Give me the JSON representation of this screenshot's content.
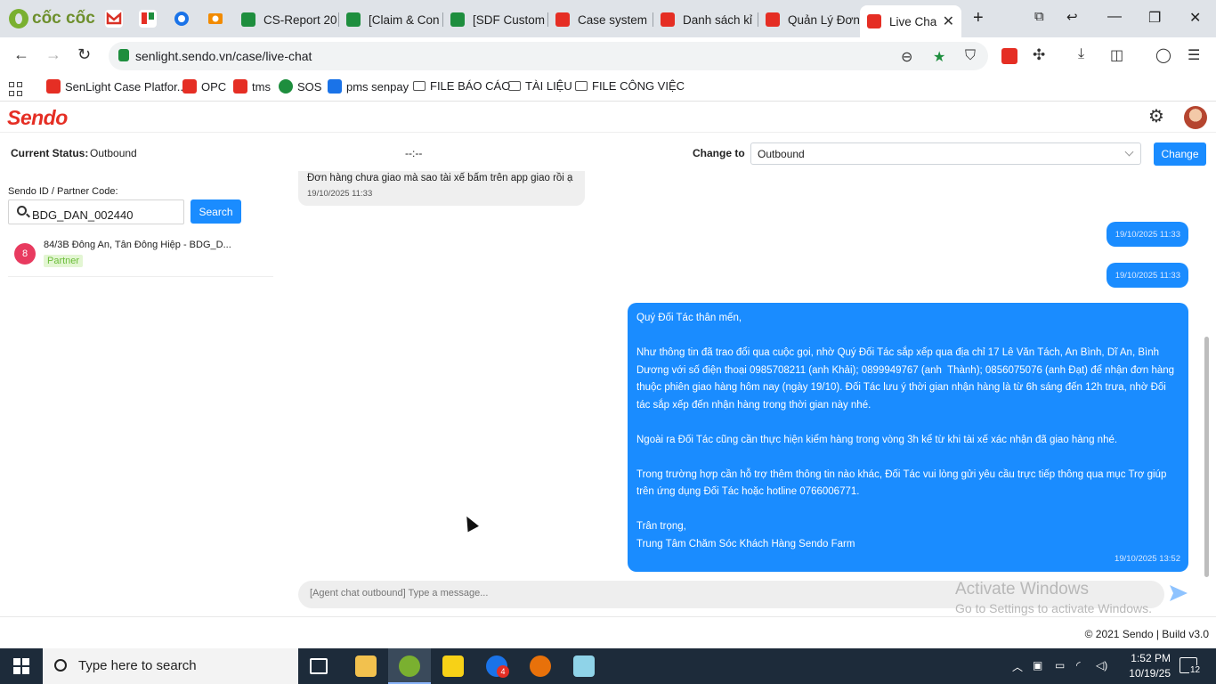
{
  "browser": {
    "brand_name": "cốc cốc",
    "tabs": [
      {
        "label": "CS-Report 20",
        "color": "#1e8e3e"
      },
      {
        "label": "[Claim & Con",
        "color": "#1e8e3e"
      },
      {
        "label": "[SDF Custom",
        "color": "#1e8e3e"
      },
      {
        "label": "Case system",
        "color": "#e52e24"
      },
      {
        "label": "Danh sách kỉ",
        "color": "#e52e24"
      },
      {
        "label": "Quản Lý Đơn",
        "color": "#e52e24"
      },
      {
        "label": "Live Cha",
        "color": "#e52e24"
      }
    ],
    "new_tab_label": "+",
    "url": "senlight.sendo.vn/case/live-chat",
    "bookmarks": [
      {
        "label": "SenLight Case Platfor...",
        "icon": "sendo-icon"
      },
      {
        "label": "OPC",
        "icon": "sendo-icon"
      },
      {
        "label": "tms",
        "icon": "sendo-icon"
      },
      {
        "label": "SOS",
        "icon": "sos-icon"
      },
      {
        "label": "pms senpay",
        "icon": "senpay-icon"
      },
      {
        "label": "FILE BÁO CÁO",
        "icon": "folder-icon"
      },
      {
        "label": "TÀI LIỆU",
        "icon": "folder-icon"
      },
      {
        "label": "FILE CÔNG VIỆC",
        "icon": "folder-icon"
      }
    ]
  },
  "app": {
    "logo_text": "Sendo",
    "status": {
      "current_label": "Current Status:",
      "current_value": "Outbound",
      "timer": "--:--",
      "change_to_label": "Change to",
      "change_to_value": "Outbound",
      "change_button": "Change"
    },
    "search": {
      "label": "Sendo ID / Partner Code:",
      "value": "BDG_DAN_002440",
      "button": "Search"
    },
    "contact": {
      "badge": "8",
      "name": "84/3B Đông An, Tân Đông Hiệp - BDG_D...",
      "tag": "Partner"
    },
    "messages": {
      "incoming": {
        "text": "Đơn hàng chưa giao mà sao tài xế bấm trên app giao rồi ạ",
        "time": "19/10/2025 11:33"
      },
      "outgoing_1_time": "19/10/2025 11:33",
      "outgoing_2_time": "19/10/2025 11:33",
      "outgoing_3": {
        "text": "Quý Đối Tác thân mến,\n\nNhư thông tin đã trao đổi qua cuộc gọi, nhờ Quý Đối Tác sắp xếp qua địa chỉ 17 Lê Văn Tách, An Bình, Dĩ An, Bình Dương với số điện thoại 0985708211 (anh Khải); 0899949767 (anh  Thành); 0856075076 (anh Đạt) để nhận đơn hàng thuộc phiên giao hàng hôm nay (ngày 19/10). Đối Tác lưu ý thời gian nhận hàng là từ 6h sáng đến 12h trưa, nhờ Đối tác sắp xếp đến nhận hàng trong thời gian này nhé.\n\nNgoài ra Đối Tác cũng cần thực hiện kiểm hàng trong vòng 3h kể từ khi tài xế xác nhận đã giao hàng nhé.\n\nTrong trường hợp cần hỗ trợ thêm thông tin nào khác, Đối Tác vui lòng gửi yêu cầu trực tiếp thông qua mục Trợ giúp trên ứng dụng Đối Tác hoặc hotline 0766006771.\n\nTrân trọng,\nTrung Tâm Chăm Sóc Khách Hàng Sendo Farm",
        "time": "19/10/2025 13:52"
      }
    },
    "composer_placeholder": "[Agent chat outbound] Type a message...",
    "footer": "© 2021 Sendo | Build v3.0"
  },
  "os": {
    "watermark_title": "Activate Windows",
    "watermark_sub": "Go to Settings to activate Windows.",
    "search_placeholder": "Type here to search",
    "time": "1:52 PM",
    "date": "10/19/25",
    "notification_count": "12",
    "zalo_badge": "4"
  },
  "colors": {
    "brand_red": "#e52e24",
    "primary_blue": "#1a8cff",
    "partner_green": "#6cbd3a"
  }
}
